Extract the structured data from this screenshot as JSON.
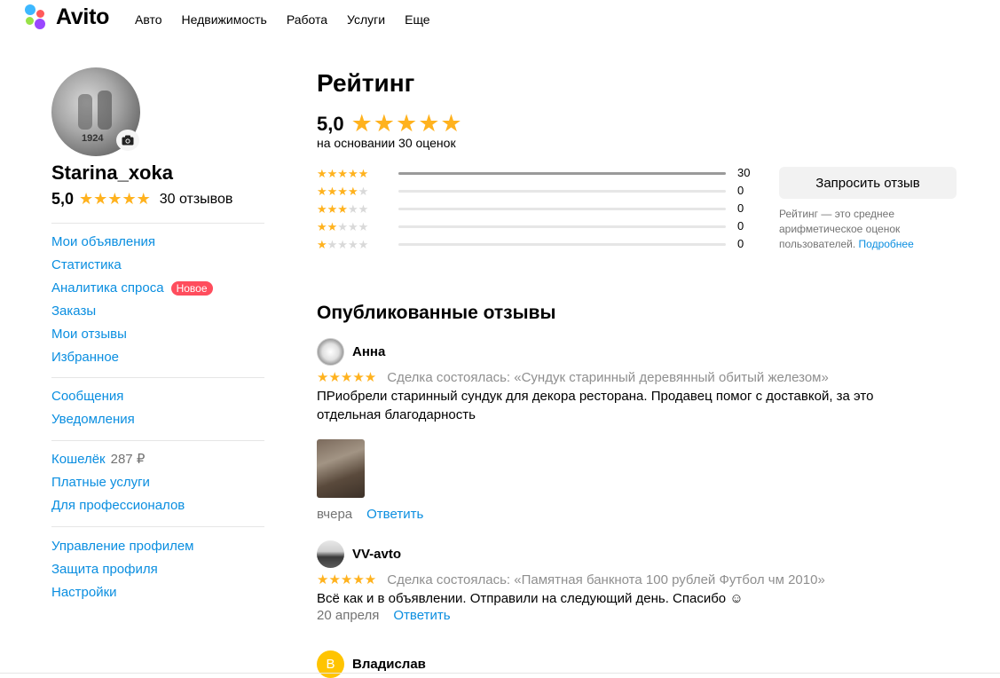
{
  "header": {
    "logo_text": "Avito",
    "nav": [
      "Авто",
      "Недвижимость",
      "Работа",
      "Услуги",
      "Еще"
    ],
    "colors": {
      "blue": "#3db8ff",
      "green": "#98e247",
      "red": "#ff5a5a",
      "purple": "#9a47ff"
    }
  },
  "profile": {
    "name": "Starina_xoka",
    "rating": "5,0",
    "reviews_count": "30 отзывов",
    "avatar_year": "1924",
    "camera_icon": "camera-icon"
  },
  "sidebar": {
    "group1": [
      {
        "label": "Мои объявления"
      },
      {
        "label": "Статистика"
      },
      {
        "label": "Аналитика спроса",
        "badge": "Новое"
      },
      {
        "label": "Заказы"
      },
      {
        "label": "Мои отзывы"
      },
      {
        "label": "Избранное"
      }
    ],
    "group2": [
      {
        "label": "Сообщения"
      },
      {
        "label": "Уведомления"
      }
    ],
    "group3": [
      {
        "label": "Кошелёк",
        "amount": "287 ₽"
      },
      {
        "label": "Платные услуги"
      },
      {
        "label": "Для профессионалов"
      }
    ],
    "group4": [
      {
        "label": "Управление профилем"
      },
      {
        "label": "Защита профиля"
      },
      {
        "label": "Настройки"
      }
    ]
  },
  "rating": {
    "title": "Рейтинг",
    "value": "5,0",
    "stars": "★★★★★",
    "based_on": "на основании 30 оценок",
    "breakdown": [
      {
        "stars": 5,
        "count": "30",
        "fraction": 1.0
      },
      {
        "stars": 4,
        "count": "0",
        "fraction": 0
      },
      {
        "stars": 3,
        "count": "0",
        "fraction": 0
      },
      {
        "stars": 2,
        "count": "0",
        "fraction": 0
      },
      {
        "stars": 1,
        "count": "0",
        "fraction": 0
      }
    ],
    "request_button": "Запросить отзыв",
    "note": "Рейтинг — это среднее арифметическое оценок пользователей.",
    "note_link": "Подробнее"
  },
  "reviews": {
    "title": "Опубликованные отзывы",
    "items": [
      {
        "author": "Анна",
        "stars": "★★★★★",
        "deal": "Сделка состоялась: «Сундук старинный деревянный обитый железом»",
        "text": "ПРиобрели старинный сундук для декора ресторана. Продавец помог с доставкой, за это отдельная благодарность",
        "date": "вчера",
        "reply": "Ответить"
      },
      {
        "author": "VV-avto",
        "stars": "★★★★★",
        "deal": "Сделка состоялась: «Памятная банкнота 100 рублей Футбол чм 2010»",
        "text": "Всё как и в объявлении. Отправили на следующий день. Спасибо ☺",
        "date": "20 апреля",
        "reply": "Ответить"
      },
      {
        "author": "Владислав",
        "initial": "В"
      }
    ]
  }
}
